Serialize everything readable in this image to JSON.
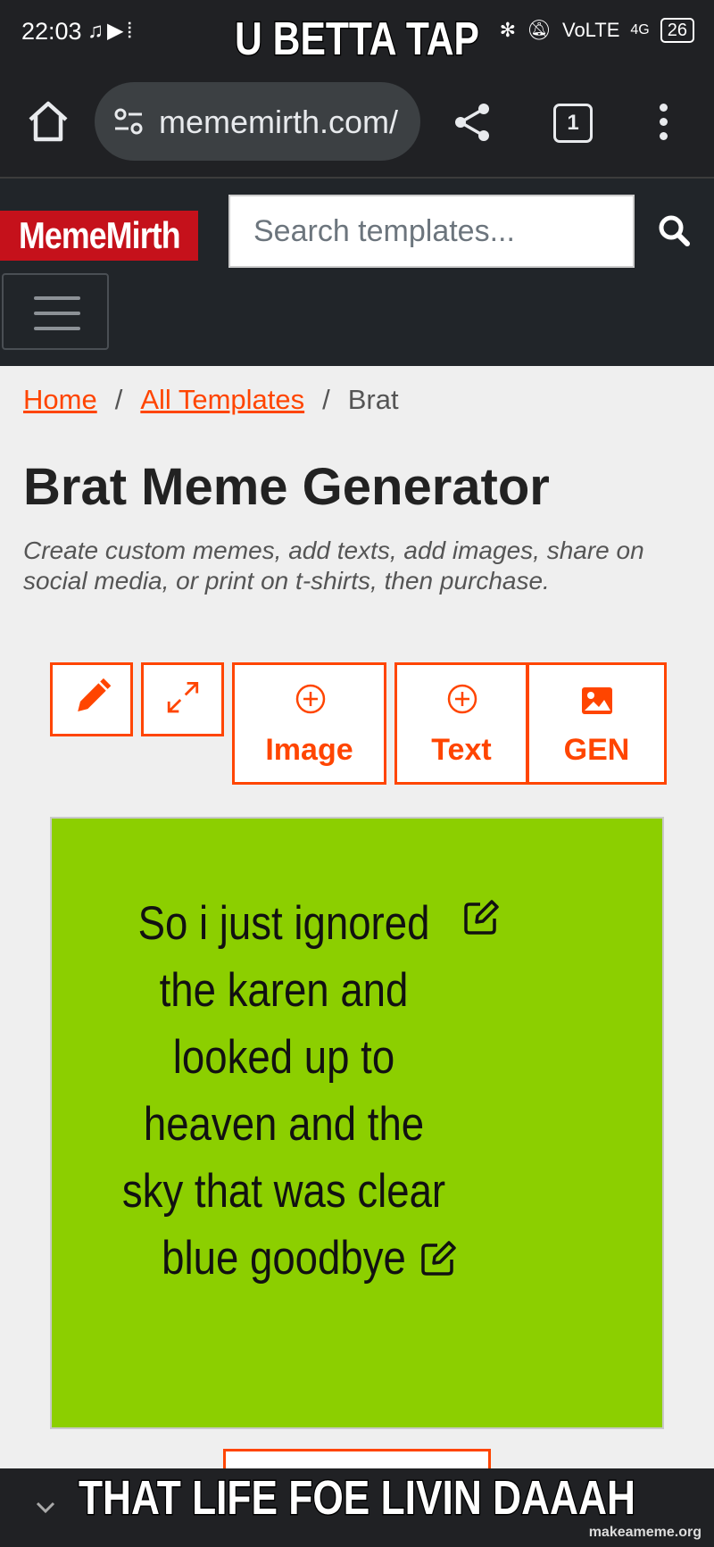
{
  "status_bar": {
    "time": "22:03",
    "network": "VoLTE",
    "signal": "4G",
    "battery": "26"
  },
  "caption_top": "U BETTA TAP",
  "caption_bottom": "THAT LIFE FOE LIVIN DAAAH",
  "watermark": "makeameme.org",
  "browser": {
    "url": "mememirth.com/",
    "tab_count": "1"
  },
  "site": {
    "logo": "MemeMirth",
    "search_placeholder": "Search templates...",
    "accent": "#ff4500",
    "brand_red": "#c5111b"
  },
  "breadcrumb": {
    "home": "Home",
    "all": "All Templates",
    "current": "Brat",
    "separator": "/"
  },
  "page": {
    "title": "Brat Meme Generator",
    "subtitle": "Create custom memes, add texts, add images, share on social media, or print on t-shirts, then purchase."
  },
  "toolbar": {
    "image_label": "Image",
    "text_label": "Text",
    "gen_label": "GEN"
  },
  "meme": {
    "background": "#8ccf00",
    "lines": [
      "So i just ignored",
      "the karen and",
      "looked up to",
      "heaven and the",
      "sky that was clear",
      "blue goodbye"
    ]
  }
}
